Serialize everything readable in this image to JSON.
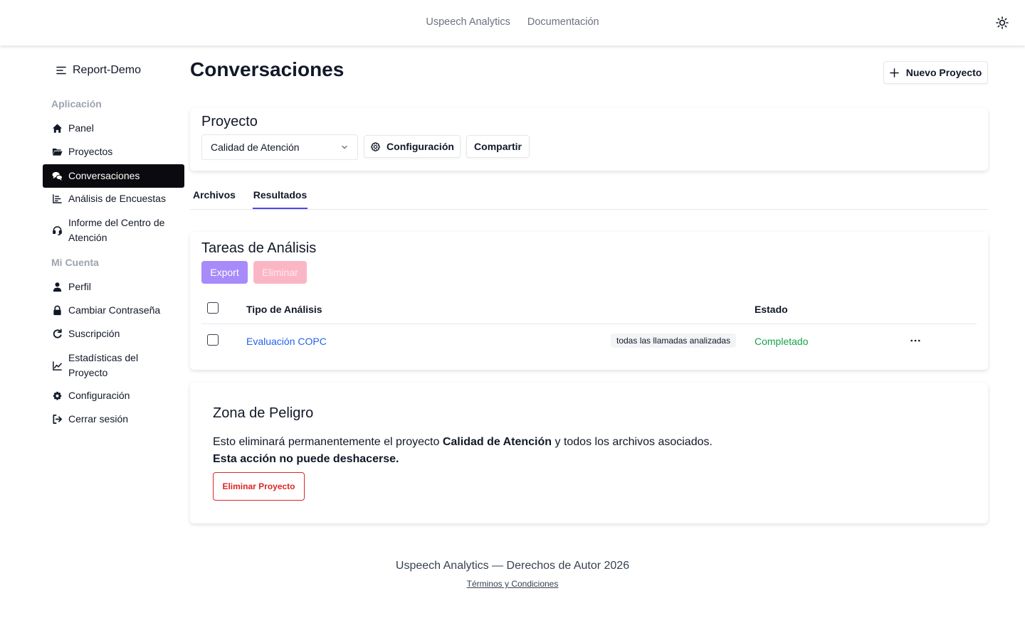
{
  "topbar": {
    "links": [
      "Uspeech Analytics",
      "Documentación"
    ],
    "theme_icon": "sun-icon"
  },
  "sidebar": {
    "brand": "Report-Demo",
    "sections": [
      {
        "label": "Aplicación"
      },
      {
        "label": "Mi Cuenta"
      }
    ],
    "app_items": [
      {
        "label": "Panel",
        "icon": "home-icon"
      },
      {
        "label": "Proyectos",
        "icon": "folder-icon"
      },
      {
        "label": "Conversaciones",
        "icon": "comments-icon",
        "active": true
      },
      {
        "label": "Análisis de Encuestas",
        "icon": "bar-chart-icon"
      },
      {
        "label": "Informe del Centro de Atención",
        "icon": "headset-icon"
      }
    ],
    "account_items": [
      {
        "label": "Perfil",
        "icon": "user-icon"
      },
      {
        "label": "Cambiar Contraseña",
        "icon": "lock-icon"
      },
      {
        "label": "Suscripción",
        "icon": "refresh-icon"
      },
      {
        "label": "Estadísticas del Proyecto",
        "icon": "line-chart-icon"
      },
      {
        "label": "Configuración",
        "icon": "gear-icon"
      },
      {
        "label": "Cerrar sesión",
        "icon": "logout-icon"
      }
    ]
  },
  "main": {
    "title": "Conversaciones",
    "new_project_label": "Nuevo Proyecto",
    "project_card": {
      "title": "Proyecto",
      "selected_project": "Calidad de Atención",
      "config_label": "Configuración",
      "share_label": "Compartir"
    },
    "tabs": [
      {
        "label": "Archivos",
        "active": false
      },
      {
        "label": "Resultados",
        "active": true
      }
    ],
    "tasks_card": {
      "title": "Tareas de Análisis",
      "export_label": "Export",
      "delete_label": "Eliminar",
      "columns": [
        "Tipo de Análisis",
        "Estado"
      ],
      "rows": [
        {
          "type": "Evaluación COPC",
          "badge": "todas las llamadas analizadas",
          "status": "Completado"
        }
      ]
    },
    "danger_card": {
      "title": "Zona de Peligro",
      "text_before": "Esto eliminará permanentemente el proyecto ",
      "project_name": "Calidad de Atención",
      "text_after": " y todos los archivos asociados.",
      "warning": "Esta acción no puede deshacerse.",
      "button_label": "Eliminar Proyecto"
    }
  },
  "footer": {
    "text": "Uspeech Analytics — Derechos de Autor 2026",
    "link": "Términos y Condiciones"
  },
  "colors": {
    "accent": "#4f46e5",
    "active_nav": "#0b0b0f",
    "link": "#2563eb",
    "success": "#16a34a",
    "danger": "#dc2626",
    "export_button": "#a78bfa",
    "delete_button": "#fbb6c5"
  }
}
